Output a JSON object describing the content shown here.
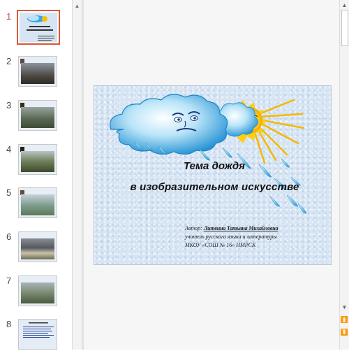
{
  "thumbnails": [
    {
      "number": "1",
      "title": "",
      "active": true
    },
    {
      "number": "2",
      "title": "",
      "active": false
    },
    {
      "number": "3",
      "title": "",
      "active": false
    },
    {
      "number": "4",
      "title": "",
      "active": false
    },
    {
      "number": "5",
      "title": "",
      "active": false
    },
    {
      "number": "6",
      "title": "",
      "active": false
    },
    {
      "number": "7",
      "title": "",
      "active": false
    },
    {
      "number": "8",
      "title": "",
      "active": false
    }
  ],
  "slide": {
    "title_line1": "Тема дождя",
    "title_line2": "в изобразительном  искусстве",
    "author_label": "Автор: ",
    "author_name": "Литвина Татьяна Михайловна",
    "author_role": "учитель русского языка и литературы",
    "author_school": "МКОУ «СОШ № 16» НМРСК"
  },
  "icons": {
    "thumb_scroll_up": "triangle-up",
    "scroll_up": "triangle-up",
    "scroll_down": "triangle-down",
    "prev_slide": "double-chevron-up",
    "next_slide": "double-chevron-down"
  },
  "colors": {
    "active_thumb_border": "#d9573a",
    "slide_background": "#d6e4f3",
    "cloud_blue": "#3aa7e0",
    "sun_yellow": "#f5c400"
  }
}
